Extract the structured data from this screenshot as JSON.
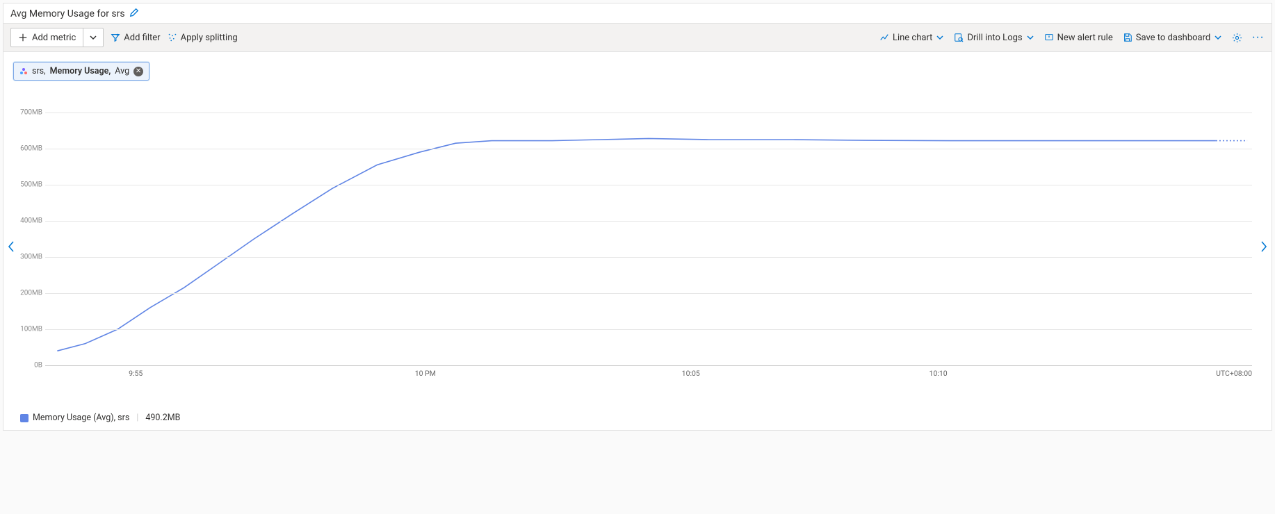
{
  "header": {
    "title": "Avg Memory Usage for srs"
  },
  "toolbar": {
    "add_metric": "Add metric",
    "add_filter": "Add filter",
    "apply_splitting": "Apply splitting",
    "line_chart": "Line chart",
    "drill_logs": "Drill into Logs",
    "new_alert": "New alert rule",
    "save_dashboard": "Save to dashboard"
  },
  "pill": {
    "resource": "srs, ",
    "metric": "Memory Usage,",
    "agg": " Avg"
  },
  "legend": {
    "label": "Memory Usage (Avg), srs",
    "value": "490.2MB"
  },
  "timezone": "UTC+08:00",
  "chart_data": {
    "type": "line",
    "title": "Avg Memory Usage for srs",
    "xlabel": "",
    "ylabel": "",
    "ylim": [
      0,
      750
    ],
    "y_ticks": [
      0,
      100,
      200,
      300,
      400,
      500,
      600,
      700
    ],
    "y_tick_labels": [
      "0B",
      "100MB",
      "200MB",
      "300MB",
      "400MB",
      "500MB",
      "600MB",
      "700MB"
    ],
    "x_ticks": [
      "9:55",
      "10 PM",
      "10:05",
      "10:10"
    ],
    "x_tick_positions_pct": [
      7.5,
      31.5,
      53.5,
      74.0
    ],
    "series": [
      {
        "name": "Memory Usage (Avg), srs",
        "color": "#6085e5",
        "points": [
          {
            "xpct": 1.0,
            "y": 40
          },
          {
            "xpct": 3.3,
            "y": 60
          },
          {
            "xpct": 6.0,
            "y": 100
          },
          {
            "xpct": 8.7,
            "y": 160
          },
          {
            "xpct": 11.5,
            "y": 215
          },
          {
            "xpct": 14.3,
            "y": 280
          },
          {
            "xpct": 17.3,
            "y": 350
          },
          {
            "xpct": 20.5,
            "y": 420
          },
          {
            "xpct": 23.8,
            "y": 490
          },
          {
            "xpct": 27.5,
            "y": 555
          },
          {
            "xpct": 31.0,
            "y": 590
          },
          {
            "xpct": 34.0,
            "y": 615
          },
          {
            "xpct": 37.0,
            "y": 622
          },
          {
            "xpct": 42.0,
            "y": 622
          },
          {
            "xpct": 46.0,
            "y": 625
          },
          {
            "xpct": 50.0,
            "y": 628
          },
          {
            "xpct": 55.0,
            "y": 625
          },
          {
            "xpct": 62.0,
            "y": 625
          },
          {
            "xpct": 68.0,
            "y": 623
          },
          {
            "xpct": 75.0,
            "y": 622
          },
          {
            "xpct": 82.0,
            "y": 622
          },
          {
            "xpct": 90.0,
            "y": 622
          },
          {
            "xpct": 97.0,
            "y": 622
          }
        ],
        "trailing_dotted": [
          {
            "xpct": 97.0,
            "y": 622
          },
          {
            "xpct": 99.6,
            "y": 622
          }
        ]
      }
    ]
  }
}
